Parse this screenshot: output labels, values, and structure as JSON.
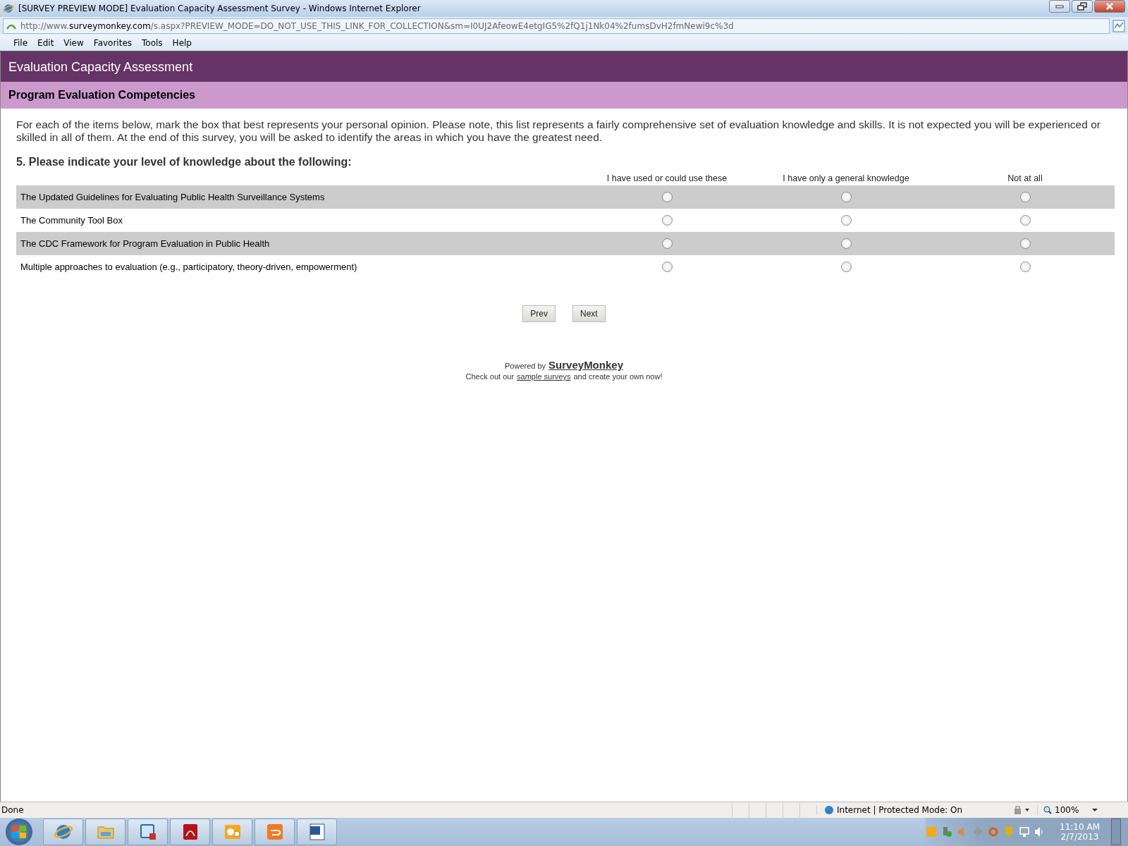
{
  "window": {
    "title": "[SURVEY PREVIEW MODE] Evaluation Capacity Assessment Survey - Windows Internet Explorer"
  },
  "address_bar": {
    "prefix": "http://www.",
    "domain": "surveymonkey.com",
    "path": "/s.aspx?PREVIEW_MODE=DO_NOT_USE_THIS_LINK_FOR_COLLECTION&sm=I0UJ2AfeowE4etgIG5%2fQ1j1Nk04%2fumsDvH2fmNewi9c%3d"
  },
  "menu_bar": [
    "File",
    "Edit",
    "View",
    "Favorites",
    "Tools",
    "Help"
  ],
  "survey": {
    "title": "Evaluation Capacity Assessment",
    "page_title": "Program Evaluation Competencies",
    "intro": "For each of the items below, mark the box that best represents your personal opinion. Please note, this list represents a fairly comprehensive set of evaluation knowledge and skills. It is not expected you will be experienced or skilled in all of them. At the end of this survey, you will be asked to identify the areas in which you have the greatest need.",
    "question": "5. Please indicate your level of knowledge about the following:",
    "columns": [
      "I have used or could use these",
      "I have only a general knowledge",
      "Not at all"
    ],
    "rows": [
      {
        "label": "The Updated Guidelines for Evaluating Public Health Surveillance Systems",
        "choices": [
          {
            "selected": false
          },
          {
            "selected": false
          },
          {
            "selected": false
          }
        ]
      },
      {
        "label": "The Community Tool Box",
        "choices": [
          {
            "selected": false
          },
          {
            "selected": false
          },
          {
            "selected": false
          }
        ]
      },
      {
        "label": "The CDC Framework for Program Evaluation in Public Health",
        "choices": [
          {
            "selected": false
          },
          {
            "selected": false
          },
          {
            "selected": false
          }
        ]
      },
      {
        "label": "Multiple approaches to evaluation (e.g., participatory, theory-driven, empowerment)",
        "choices": [
          {
            "selected": false
          },
          {
            "selected": false
          },
          {
            "selected": false
          }
        ]
      }
    ],
    "buttons": [
      "Prev",
      "Next"
    ],
    "footer": {
      "powered_by": "Powered by",
      "brand": "SurveyMonkey",
      "line_start": "Check out our",
      "link": "sample surveys",
      "line_end": "and create your own now!"
    }
  },
  "status_bar": {
    "status": "Done",
    "zone": "Internet | Protected Mode: On",
    "zoom": "100%"
  },
  "taskbar": {
    "time": "11:10 AM",
    "date": "2/7/2013"
  }
}
